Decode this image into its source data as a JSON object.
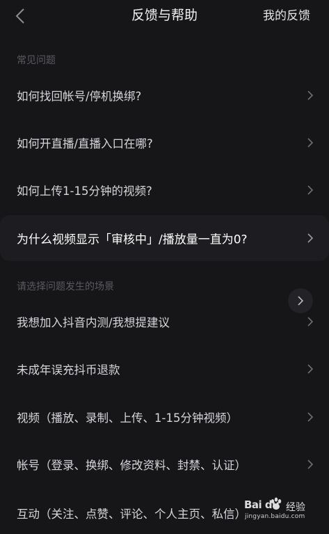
{
  "nav": {
    "title": "反馈与帮助",
    "right_link": "我的反馈",
    "back_icon": "chevron-left-icon"
  },
  "sections": {
    "faq_label": "常见问题",
    "scenario_label": "请选择问题发生的场景"
  },
  "faq_items": [
    {
      "label": "如何找回帐号/停机换绑?"
    },
    {
      "label": "如何开直播/直播入口在哪?"
    },
    {
      "label": "如何上传1-15分钟的视频?"
    },
    {
      "label": "为什么视频显示「审核中」/播放量一直为0?"
    }
  ],
  "scenario_items": [
    {
      "label": "我想加入抖音内测/我想提建议"
    },
    {
      "label": "未成年误充抖币退款"
    },
    {
      "label": "视频（播放、录制、上传、1-15分钟视频）"
    },
    {
      "label": "帐号（登录、换绑、修改资料、封禁、认证）"
    },
    {
      "label": "互动（关注、点赞、评论、个人主页、私信）"
    }
  ],
  "watermark": {
    "logo": "Bai du",
    "suffix": "经验",
    "url": "jingyan.baidu.com"
  },
  "colors": {
    "background": "#161619",
    "highlight_row": "#1d1d21",
    "section_label": "#5a5a5f",
    "text": "#d6d6da"
  }
}
